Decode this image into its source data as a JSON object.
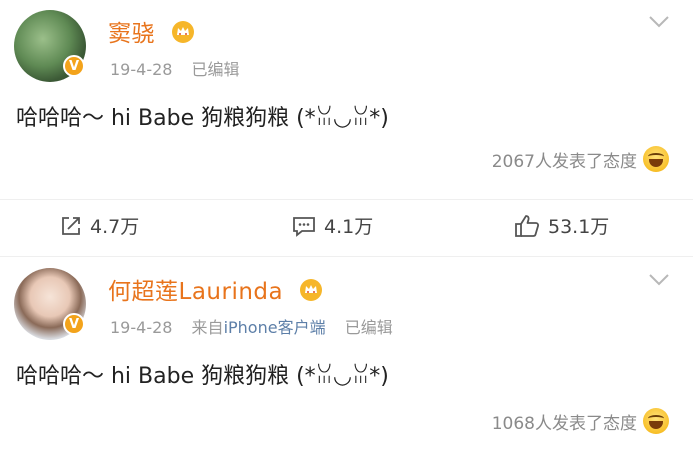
{
  "post1": {
    "username": "窦骁",
    "date": "19-4-28",
    "edited": "已编辑",
    "content": "哈哈哈～ hi Babe 狗粮狗粮 (*ꈍ◡ꈍ*)",
    "reactions_text": "2067人发表了态度",
    "actions": {
      "share": "4.7万",
      "comment": "4.1万",
      "like": "53.1万"
    },
    "verified_badge": "V"
  },
  "post2": {
    "username": "何超莲Laurinda",
    "date": "19-4-28",
    "source_prefix": "来自",
    "source_app": "iPhone",
    "source_suffix": "客户端",
    "edited": "已编辑",
    "content": "哈哈哈～ hi Babe 狗粮狗粮 (*ꈍ◡ꈍ*)",
    "reactions_text": "1068人发表了态度",
    "verified_badge": "V"
  },
  "colors": {
    "username": "#e8741c",
    "meta": "#9a9a9a",
    "link": "#5d7fa8"
  },
  "icons": [
    "crown-icon",
    "chevron-down-icon",
    "share-icon",
    "comment-icon",
    "like-icon",
    "laugh-emoji-icon",
    "verified-badge-icon"
  ]
}
